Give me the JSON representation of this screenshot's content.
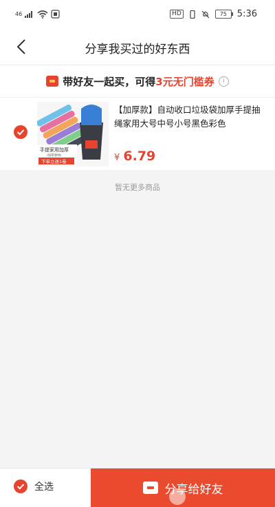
{
  "status_bar": {
    "time": "5:36",
    "battery": "75",
    "signal": "46",
    "hd": "HD"
  },
  "nav": {
    "title": "分享我买过的好东西"
  },
  "banner": {
    "text": "带好友一起买，可得",
    "highlight": "3元无门槛券"
  },
  "product": {
    "title": "【加厚款】自动收口垃圾袋加厚手提抽绳家用大号中号小号黑色彩色",
    "currency": "¥",
    "price": "6.79",
    "image_caption": "手提家用加厚",
    "image_subcaption": "(加厚收纳)",
    "image_ribbon": "下单立送1卷",
    "checked": true
  },
  "no_more_text": "暂无更多商品",
  "bottom_bar": {
    "select_all_label": "全选",
    "share_label": "分享给好友"
  },
  "colors": {
    "accent": "#e8432e",
    "share_button": "#ea4a2e"
  }
}
